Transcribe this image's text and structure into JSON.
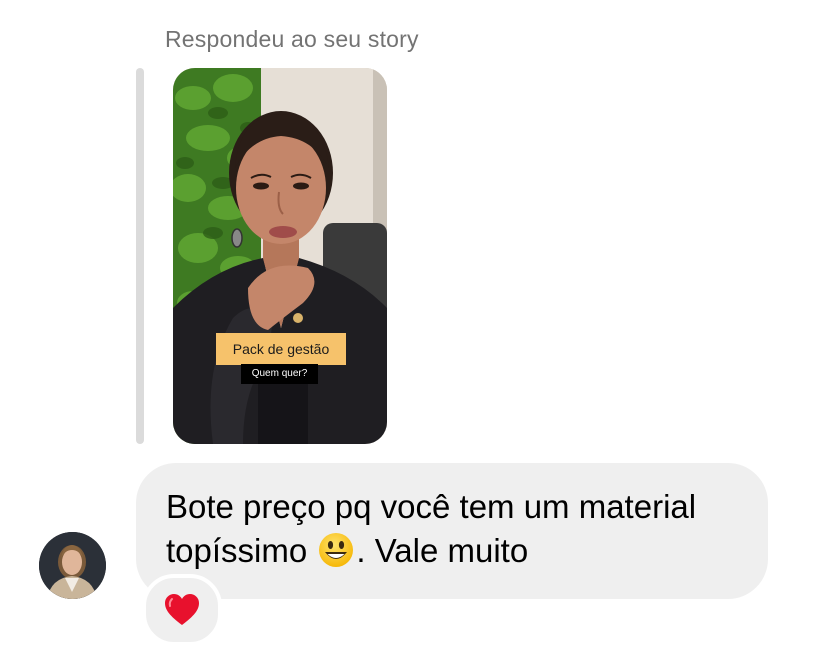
{
  "thread": {
    "reply_label": "Respondeu ao seu story",
    "story": {
      "caption": "Pack de gestão",
      "subcaption": "Quem quer?"
    },
    "message": {
      "text_part1": "Bote preço pq você tem um material topíssimo",
      "emoji": "smiley-face-icon",
      "text_part2": ". Vale muito"
    },
    "reaction": {
      "emoji": "heart-icon"
    }
  },
  "colors": {
    "bubble": "#efefef",
    "quote_bar": "#dbdbdb",
    "caption_bg": "#f6c26b",
    "label_gray": "#737373",
    "heart": "#e8112d"
  }
}
